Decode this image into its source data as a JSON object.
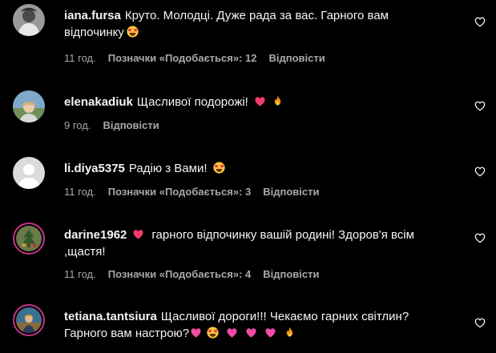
{
  "comments": [
    {
      "username": "iana.fursa",
      "text": "Круто. Молодці. Дуже рада за вас. Гарного вам відпочинку",
      "emojis": [
        "smiling-face-with-heart-eyes"
      ],
      "time": "11 год.",
      "likes": "Позначки «Подобається»: 12",
      "reply": "Відповісти"
    },
    {
      "username": "elenakadiuk",
      "text": "Щасливої подорожі!",
      "emojis": [
        "red-heart",
        "fire"
      ],
      "time": "9 год.",
      "reply": "Відповісти"
    },
    {
      "username": "li.diya5375",
      "text": "Радію з Вами!",
      "emojis": [
        "smiling-face-with-heart-eyes"
      ],
      "time": "11 год.",
      "likes": "Позначки «Подобається»: 3",
      "reply": "Відповісти"
    },
    {
      "username": "darine1962",
      "text_after_emoji": "гарного відпочинку вашій родині! Здоров'я всім ,щастя!",
      "emojis": [
        "red-heart"
      ],
      "time": "11 год.",
      "likes": "Позначки «Подобається»: 4",
      "reply": "Відповісти"
    },
    {
      "username": "tetiana.tantsiura",
      "text": "Щасливої дороги!!! Чекаємо гарних світлин? Гарного вам настрою?",
      "emojis": [
        "pink-heart",
        "smiling-face-with-heart-eyes",
        "pink-heart",
        "pink-heart",
        "pink-heart",
        "fire"
      ]
    }
  ],
  "colors": {
    "background": "#000000",
    "text": "#f5f5f5",
    "secondary": "#a8a8a8",
    "story_ring": "#c13584"
  }
}
